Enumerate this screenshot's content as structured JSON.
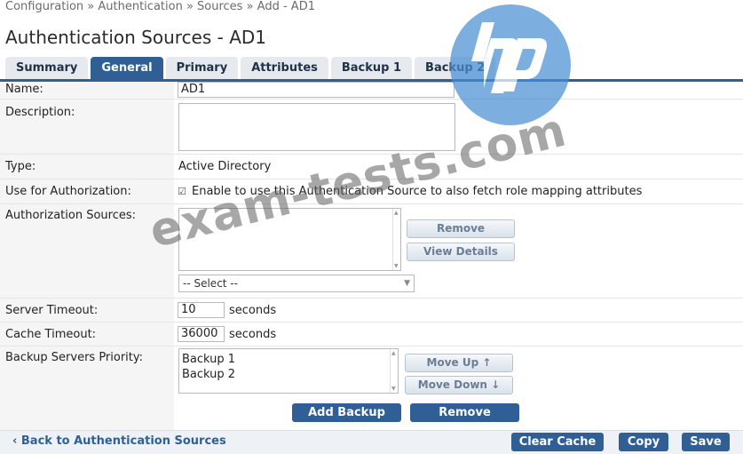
{
  "breadcrumb": "Configuration » Authentication » Sources » Add - AD1",
  "page_title": "Authentication Sources - AD1",
  "tabs": [
    {
      "label": "Summary",
      "active": false
    },
    {
      "label": "General",
      "active": true
    },
    {
      "label": "Primary",
      "active": false
    },
    {
      "label": "Attributes",
      "active": false
    },
    {
      "label": "Backup 1",
      "active": false
    },
    {
      "label": "Backup 2",
      "active": false
    }
  ],
  "form": {
    "name_label": "Name:",
    "name_value": "AD1",
    "description_label": "Description:",
    "description_value": "",
    "type_label": "Type:",
    "type_value": "Active Directory",
    "use_for_auth_label": "Use for Authorization:",
    "use_for_auth_checkbox": "☑",
    "use_for_auth_text": "Enable to use this Authentication Source to also fetch role mapping attributes",
    "auth_sources_label": "Authorization Sources:",
    "remove_label": "Remove",
    "view_details_label": "View Details",
    "select_placeholder": "-- Select --",
    "server_timeout_label": "Server Timeout:",
    "server_timeout_value": "10",
    "cache_timeout_label": "Cache Timeout:",
    "cache_timeout_value": "36000",
    "seconds": "seconds",
    "backup_priority_label": "Backup Servers Priority:",
    "backup_list": [
      "Backup 1",
      "Backup 2"
    ],
    "move_up_label": "Move Up ↑",
    "move_down_label": "Move Down ↓",
    "add_backup_label": "Add Backup",
    "remove_backup_label": "Remove"
  },
  "footer": {
    "back_label": "‹  Back to Authentication Sources",
    "clear_cache_label": "Clear Cache",
    "copy_label": "Copy",
    "save_label": "Save"
  },
  "watermark_text": "exam-tests.com",
  "colors": {
    "accent": "#2f5f95",
    "logo": "#4a8fd3"
  }
}
